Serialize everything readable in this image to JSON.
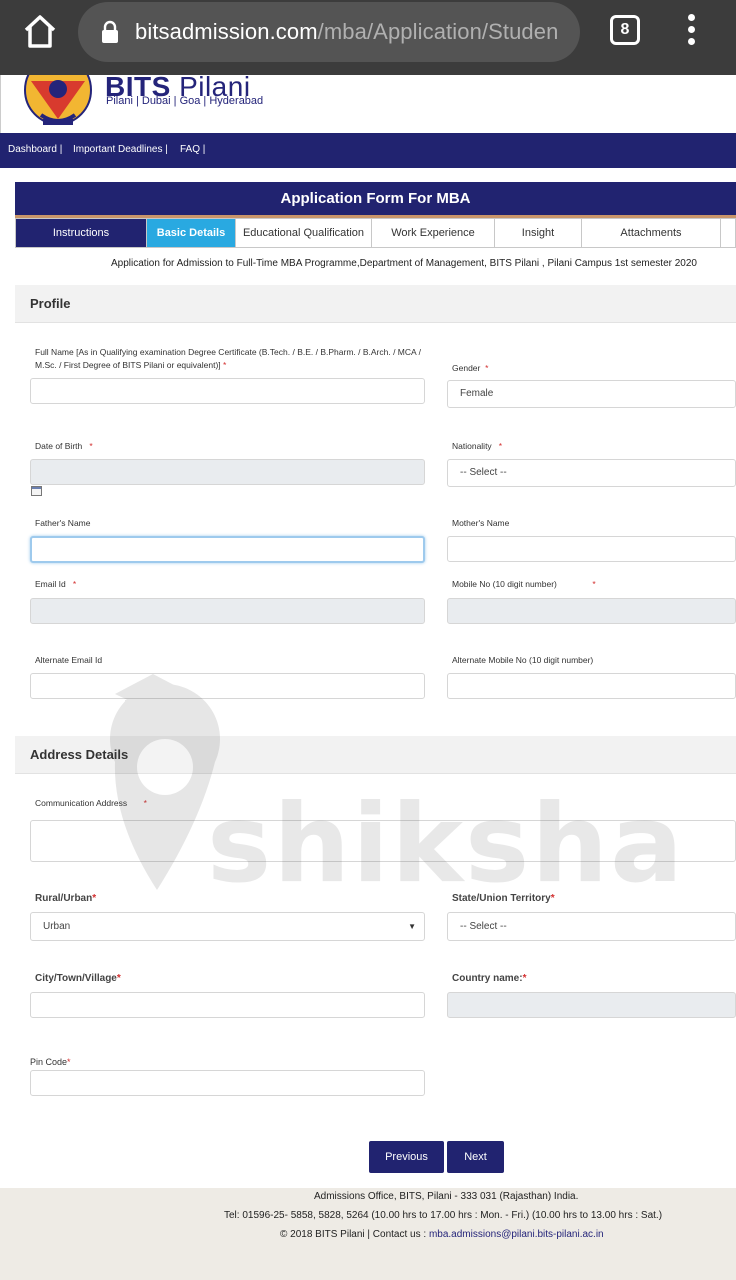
{
  "browser": {
    "url_host": "bitsadmission.com",
    "url_path": "/mba/Application/Studen",
    "tab_count": "8"
  },
  "brand": {
    "name_bold": "BITS",
    "name_light": "Pilani",
    "campuses": "Pilani | Dubai | Goa | Hyderabad"
  },
  "top_nav": {
    "items": [
      "Dashboard |",
      "Important Deadlines |",
      "FAQ |"
    ]
  },
  "form": {
    "title": "Application Form For MBA",
    "tabs": [
      "Instructions",
      "Basic Details",
      "Educational Qualification",
      "Work Experience",
      "Insight",
      "Attachments"
    ],
    "active_tab": "Basic Details",
    "subtitle": "Application for Admission to Full-Time MBA Programme,Department of Management, BITS Pilani , Pilani Campus 1st semester 2020"
  },
  "profile": {
    "section_title": "Profile",
    "full_name_label": "Full Name [As in Qualifying examination Degree Certificate (B.Tech. / B.E. / B.Pharm. / B.Arch. / MCA / M.Sc. / First Degree of BITS Pilani or equivalent)]",
    "gender_label": "Gender",
    "gender_value": "Female",
    "dob_label": "Date of Birth",
    "nationality_label": "Nationality",
    "nationality_value": "-- Select --",
    "father_label": "Father's Name",
    "mother_label": "Mother's Name",
    "email_label": "Email Id",
    "mobile_label": "Mobile No (10 digit number)",
    "alt_email_label": "Alternate Email Id",
    "alt_mobile_label": "Alternate Mobile No (10 digit number)"
  },
  "address": {
    "section_title": "Address Details",
    "comm_label": "Communication Address",
    "rural_label": "Rural/Urban",
    "rural_value": "Urban",
    "state_label": "State/Union Territory",
    "state_value": "-- Select --",
    "city_label": "City/Town/Village",
    "country_label": "Country name:",
    "pin_label": "Pin Code"
  },
  "required_mark": "*",
  "buttons": {
    "previous": "Previous",
    "next": "Next"
  },
  "watermark": "shiksha",
  "footer": {
    "line1": "Admissions Office, BITS, Pilani - 333 031 (Rajasthan) India.",
    "line2": "Tel: 01596-25- 5858, 5828, 5264 (10.00 hrs to 17.00 hrs : Mon. - Fri.) (10.00 hrs to 13.00 hrs : Sat.)",
    "line3_prefix": "© 2018 BITS Pilani | Contact us :",
    "contact_email": "mba.admissions@pilani.bits-pilani.ac.in"
  }
}
